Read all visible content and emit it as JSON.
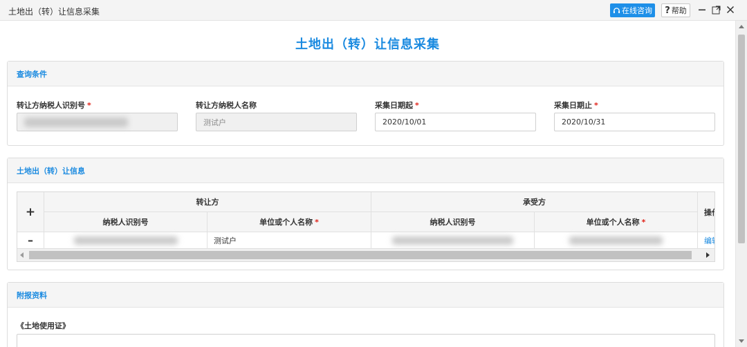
{
  "window": {
    "title": "土地出（转）让信息采集",
    "online_consult_label": "在线咨询",
    "help_label": "帮助"
  },
  "page_title": "土地出（转）让信息采集",
  "query": {
    "section_title": "查询条件",
    "fields": {
      "transferor_tax_id": {
        "label": "转让方纳税人识别号",
        "value": ""
      },
      "transferor_name": {
        "label": "转让方纳税人名称",
        "value": "测试户"
      },
      "date_start": {
        "label": "采集日期起",
        "value": "2020/10/01"
      },
      "date_end": {
        "label": "采集日期止",
        "value": "2020/10/31"
      }
    },
    "required_mark": "*"
  },
  "transfer_info": {
    "section_title": "土地出（转）让信息",
    "group_headers": [
      "转让方",
      "承受方"
    ],
    "columns": [
      "纳税人识别号",
      "单位或个人名称",
      "纳税人识别号",
      "单位或个人名称"
    ],
    "operation_header": "操作",
    "add_symbol": "+",
    "remove_symbol": "–",
    "rows": [
      {
        "transferor_tax_id": "",
        "transferor_name": "测试户",
        "receiver_tax_id": "",
        "receiver_name": "",
        "action": "编辑"
      }
    ]
  },
  "attachments": {
    "section_title": "附报资料",
    "item_label": "《土地使用证》"
  },
  "colors": {
    "accent": "#1a8ae0",
    "online_button": "#1e8fe8",
    "required": "#e0241b"
  },
  "icons": [
    "headset-icon",
    "minimize-icon",
    "restore-icon",
    "close-icon"
  ]
}
